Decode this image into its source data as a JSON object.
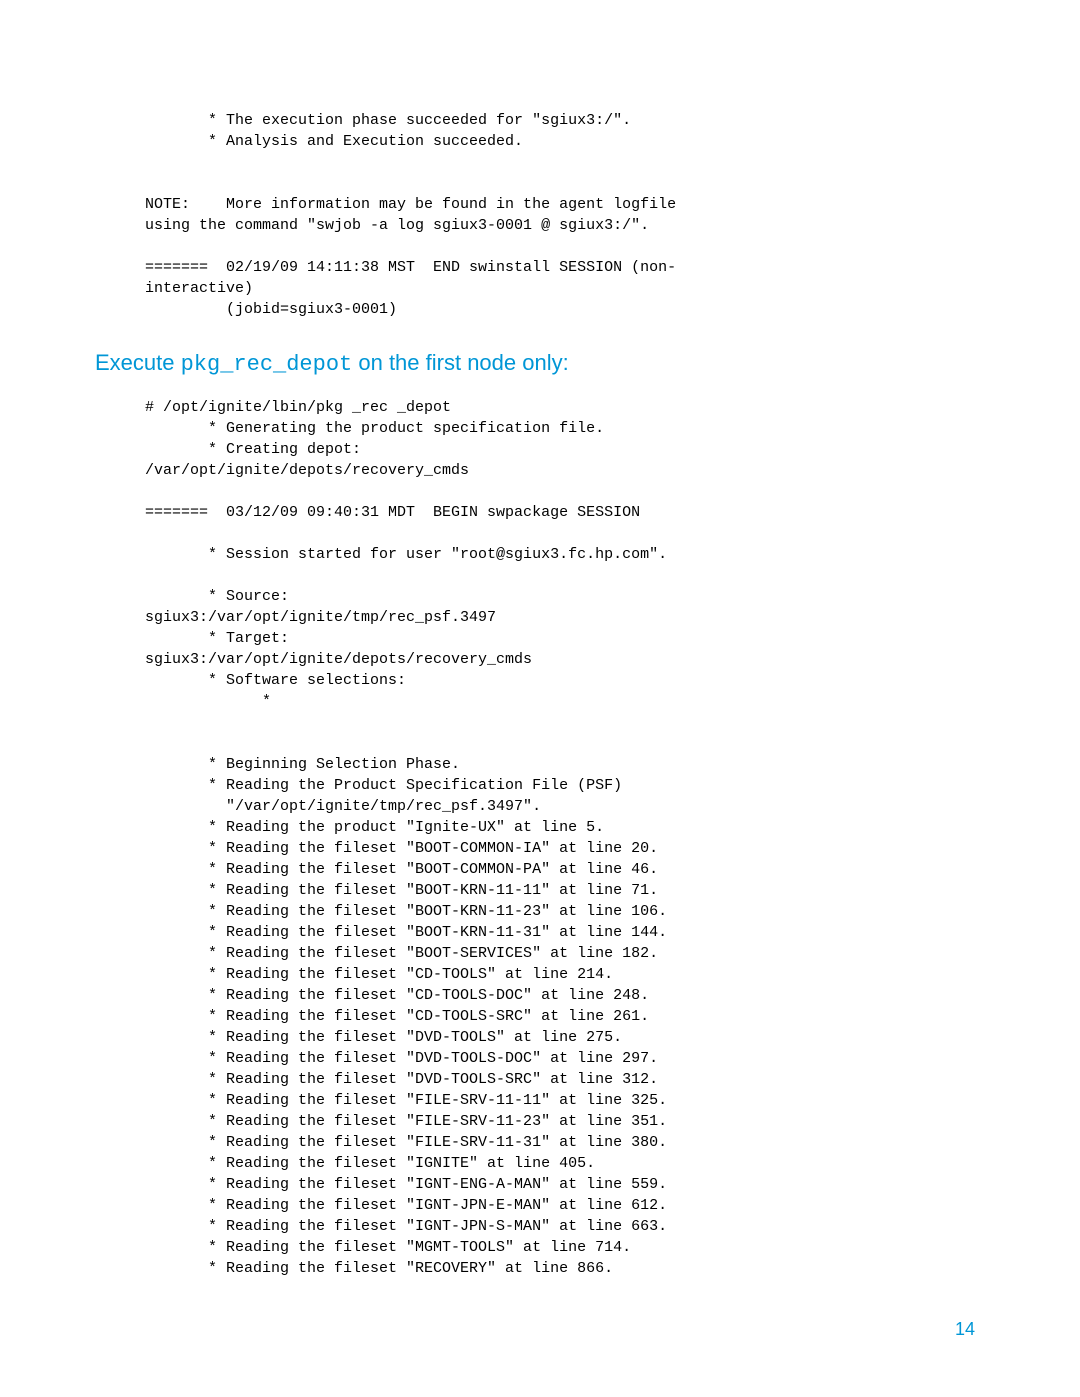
{
  "code_block_1": "       * The execution phase succeeded for \"sgiux3:/\".\n       * Analysis and Execution succeeded.\n\n\nNOTE:    More information may be found in the agent logfile\nusing the command \"swjob -a log sgiux3-0001 @ sgiux3:/\".\n\n=======  02/19/09 14:11:38 MST  END swinstall SESSION (non-\ninteractive)\n         (jobid=sgiux3-0001)",
  "heading": {
    "prefix": "Execute ",
    "mono": "pkg_rec_depot",
    "suffix": " on the first node only:"
  },
  "code_block_2": "# /opt/ignite/lbin/pkg _rec _depot\n       * Generating the product specification file.\n       * Creating depot:\n/var/opt/ignite/depots/recovery_cmds\n\n=======  03/12/09 09:40:31 MDT  BEGIN swpackage SESSION\n\n       * Session started for user \"root@sgiux3.fc.hp.com\".\n\n       * Source:\nsgiux3:/var/opt/ignite/tmp/rec_psf.3497\n       * Target:\nsgiux3:/var/opt/ignite/depots/recovery_cmds\n       * Software selections:\n             *\n\n\n       * Beginning Selection Phase.\n       * Reading the Product Specification File (PSF)\n         \"/var/opt/ignite/tmp/rec_psf.3497\".\n       * Reading the product \"Ignite-UX\" at line 5.\n       * Reading the fileset \"BOOT-COMMON-IA\" at line 20.\n       * Reading the fileset \"BOOT-COMMON-PA\" at line 46.\n       * Reading the fileset \"BOOT-KRN-11-11\" at line 71.\n       * Reading the fileset \"BOOT-KRN-11-23\" at line 106.\n       * Reading the fileset \"BOOT-KRN-11-31\" at line 144.\n       * Reading the fileset \"BOOT-SERVICES\" at line 182.\n       * Reading the fileset \"CD-TOOLS\" at line 214.\n       * Reading the fileset \"CD-TOOLS-DOC\" at line 248.\n       * Reading the fileset \"CD-TOOLS-SRC\" at line 261.\n       * Reading the fileset \"DVD-TOOLS\" at line 275.\n       * Reading the fileset \"DVD-TOOLS-DOC\" at line 297.\n       * Reading the fileset \"DVD-TOOLS-SRC\" at line 312.\n       * Reading the fileset \"FILE-SRV-11-11\" at line 325.\n       * Reading the fileset \"FILE-SRV-11-23\" at line 351.\n       * Reading the fileset \"FILE-SRV-11-31\" at line 380.\n       * Reading the fileset \"IGNITE\" at line 405.\n       * Reading the fileset \"IGNT-ENG-A-MAN\" at line 559.\n       * Reading the fileset \"IGNT-JPN-E-MAN\" at line 612.\n       * Reading the fileset \"IGNT-JPN-S-MAN\" at line 663.\n       * Reading the fileset \"MGMT-TOOLS\" at line 714.\n       * Reading the fileset \"RECOVERY\" at line 866.",
  "page_number": "14"
}
